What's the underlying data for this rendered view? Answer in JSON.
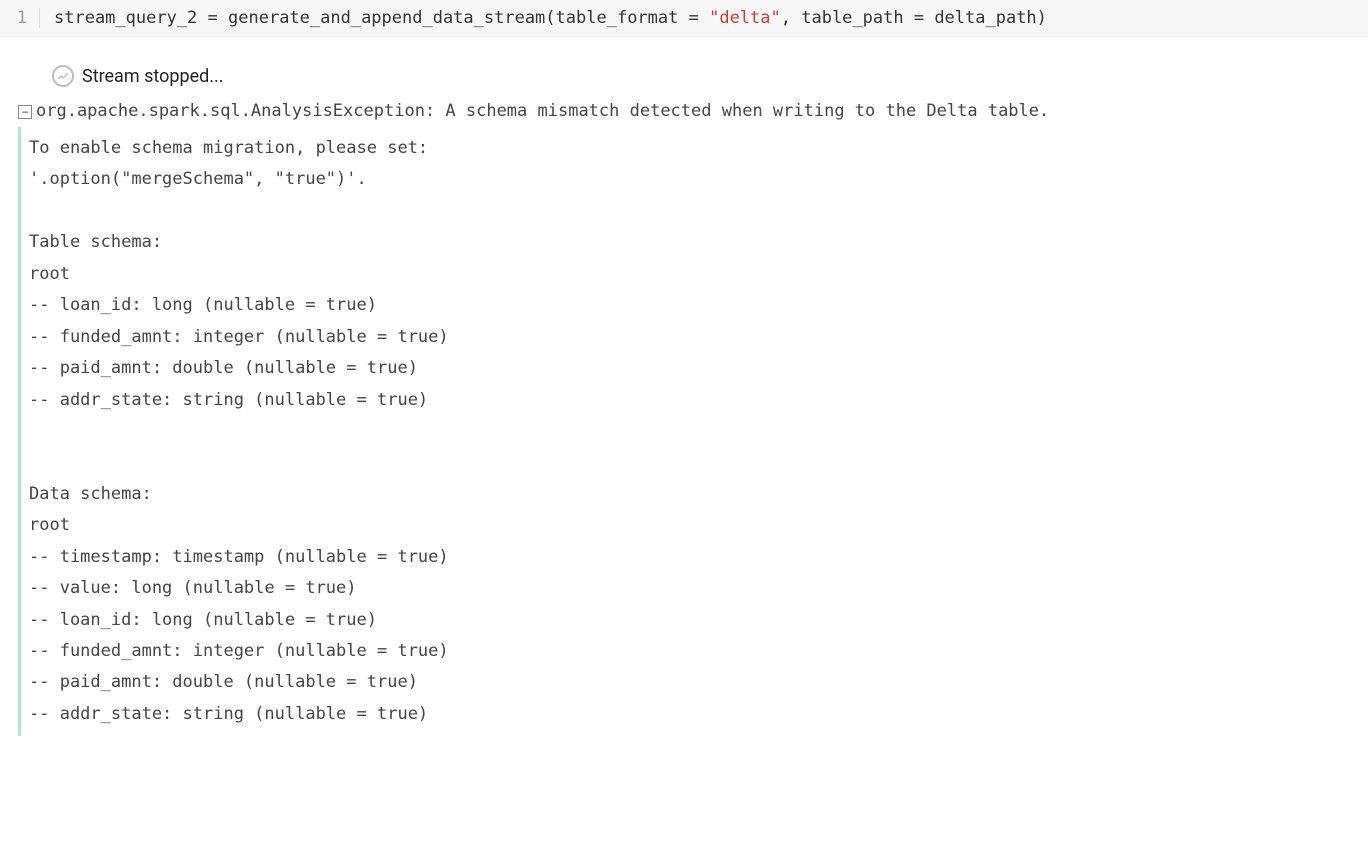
{
  "code_cell": {
    "line_number": "1",
    "code_tokens": {
      "var_name": "stream_query_2",
      "assign": " = ",
      "func_name": "generate_and_append_data_stream",
      "open_paren": "(",
      "param1_name": "table_format",
      "param1_assign": " = ",
      "param1_value": "\"delta\"",
      "comma": ", ",
      "param2_name": "table_path",
      "param2_assign": " = ",
      "param2_value": "delta_path",
      "close_paren": ")"
    }
  },
  "output": {
    "stream_status_text": "Stream stopped...",
    "collapse_symbol": "−",
    "error_header_text": "org.apache.spark.sql.AnalysisException: A schema mismatch detected when writing to the Delta table.",
    "error_detail": "To enable schema migration, please set:\n'.option(\"mergeSchema\", \"true\")'.\n\nTable schema:\nroot\n-- loan_id: long (nullable = true)\n-- funded_amnt: integer (nullable = true)\n-- paid_amnt: double (nullable = true)\n-- addr_state: string (nullable = true)\n\n\nData schema:\nroot\n-- timestamp: timestamp (nullable = true)\n-- value: long (nullable = true)\n-- loan_id: long (nullable = true)\n-- funded_amnt: integer (nullable = true)\n-- paid_amnt: double (nullable = true)\n-- addr_state: string (nullable = true)"
  }
}
